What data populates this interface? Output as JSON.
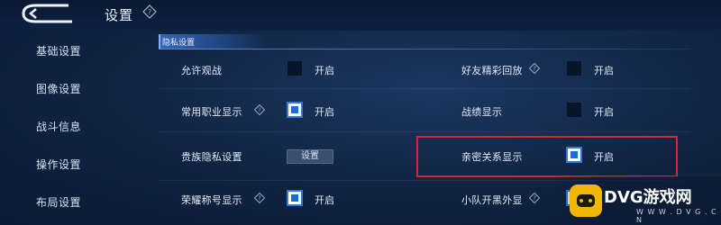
{
  "header": {
    "title": "设置"
  },
  "sidebar": {
    "items": [
      {
        "label": "基础设置"
      },
      {
        "label": "图像设置"
      },
      {
        "label": "战斗信息"
      },
      {
        "label": "操作设置"
      },
      {
        "label": "布局设置"
      }
    ]
  },
  "section": {
    "label": "隐私设置"
  },
  "settings": {
    "allow_watch": {
      "label": "允许观战",
      "state": "开启",
      "checked": false
    },
    "friend_replay": {
      "label": "好友精彩回放",
      "state": "开启",
      "checked": false
    },
    "common_job": {
      "label": "常用职业显示",
      "state": "开启",
      "checked": true
    },
    "record": {
      "label": "战绩显示",
      "state": "开启",
      "checked": false
    },
    "noble_privacy": {
      "label": "贵族隐私设置",
      "button": "设置"
    },
    "intimacy": {
      "label": "亲密关系显示",
      "state": "开启",
      "checked": true
    },
    "honor_title": {
      "label": "荣耀称号显示",
      "state": "开启",
      "checked": true
    },
    "team_skin": {
      "label": "小队开黑外显",
      "checked": true
    }
  },
  "watermark": {
    "brand": "DVG游戏网",
    "url": "W W W . D V G . C N"
  },
  "colors": {
    "accent": "#1e6ad6",
    "highlight": "#d12a2a",
    "background": "#0f2340"
  }
}
